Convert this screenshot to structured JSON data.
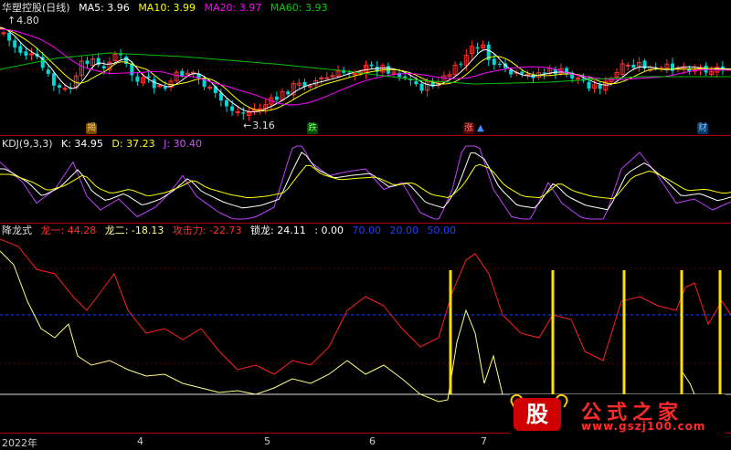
{
  "colors": {
    "bg": "#000000",
    "up": "#ff3030",
    "down": "#00d8d8",
    "ma5": "#ffffff",
    "ma10": "#ffff00",
    "ma20": "#ff00ff",
    "ma60": "#00c000",
    "k": "#ffffff",
    "d": "#ffff00",
    "j": "#c040ff",
    "long1": "#ff2020",
    "long2": "#ffff80",
    "sep": "#b00000",
    "signal": "#ffe000"
  },
  "panel1": {
    "title": "华塑控股(日线)",
    "ma5": "MA5: 3.96",
    "ma10": "MA10: 3.99",
    "ma20": "MA20: 3.97",
    "ma60": "MA60: 3.93",
    "high_label": "4.80",
    "low_label": "3.16"
  },
  "markers": {
    "m1": "揭",
    "m2": "跌",
    "m3": "涨",
    "m4": "财"
  },
  "panel2": {
    "title": "KDJ(9,3,3)",
    "k": "K: 34.95",
    "d": "D: 37.23",
    "j": "J: 30.40"
  },
  "panel3": {
    "title": "降龙式",
    "l1": "龙一: 44.28",
    "l2": "龙二: -18.13",
    "attack": "攻击力: -22.73",
    "lock": "锁龙: 24.11",
    "zero": ": 0.00",
    "lv70": "70.00",
    "lv20": "20.00",
    "lv50": "50.00"
  },
  "xaxis": {
    "labels": [
      "2022年",
      "4",
      "5",
      "6",
      "7"
    ]
  },
  "watermark": {
    "logo": "股",
    "name": "公式之家",
    "url": "www.gszj100.com"
  },
  "chart_data": [
    {
      "type": "line",
      "title": "华塑控股(日线)",
      "series": [
        {
          "name": "MA5",
          "last": 3.96
        },
        {
          "name": "MA10",
          "last": 3.99
        },
        {
          "name": "MA20",
          "last": 3.97
        },
        {
          "name": "MA60",
          "last": 3.93
        }
      ],
      "annotations": [
        "4.80",
        "3.16"
      ]
    },
    {
      "type": "line",
      "title": "KDJ(9,3,3)",
      "series": [
        {
          "name": "K",
          "last": 34.95
        },
        {
          "name": "D",
          "last": 37.23
        },
        {
          "name": "J",
          "last": 30.4
        }
      ]
    },
    {
      "type": "line",
      "title": "降龙式",
      "series": [
        {
          "name": "龙一",
          "last": 44.28
        },
        {
          "name": "龙二",
          "last": -18.13
        },
        {
          "name": "攻击力",
          "last": -22.73
        },
        {
          "name": "锁龙",
          "last": 24.11
        }
      ],
      "levels": [
        70,
        20,
        50
      ]
    }
  ]
}
